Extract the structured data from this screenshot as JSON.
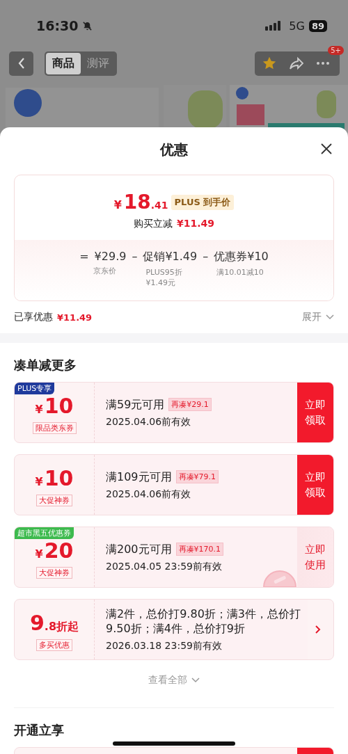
{
  "status_bar": {
    "time": "16:30",
    "network": "5G",
    "battery": "89"
  },
  "nav": {
    "tabs": [
      {
        "label": "商品",
        "selected": true
      },
      {
        "label": "测评",
        "selected": false
      }
    ],
    "badge": "5+"
  },
  "sheet": {
    "title": "优惠"
  },
  "price_summary": {
    "currency": "¥",
    "integer": "18",
    "decimal": ".41",
    "tag": "PLUS 到手价",
    "saving_label": "购买立减",
    "saving_amount": "¥11.49",
    "breakdown": [
      {
        "operator": "=",
        "value": "¥29.9",
        "notes": [
          "京东价"
        ]
      },
      {
        "operator": "–",
        "value": "促销¥1.49",
        "notes": [
          "PLUS95折",
          "¥1.49元"
        ]
      },
      {
        "operator": "–",
        "value": "优惠券¥10",
        "notes": [
          "满10.01减10"
        ]
      }
    ]
  },
  "enjoyed": {
    "label": "已享优惠",
    "amount": "¥11.49",
    "expand": "展开"
  },
  "more_section": {
    "title": "凑单减更多",
    "coupons": [
      {
        "badge": "PLUS专享",
        "color": "#1f3a9c",
        "currency": "¥",
        "amount": "10",
        "tag": "限品类东券",
        "condition": "满59元可用",
        "gap": "再凑¥29.1",
        "validity": "2025.04.06前有效",
        "kind": "claim",
        "action": "立即领取",
        "stamped": false
      },
      {
        "currency": "¥",
        "amount": "10",
        "tag": "大促神券",
        "condition": "满109元可用",
        "gap": "再凑¥79.1",
        "validity": "2025.04.06前有效",
        "kind": "claim",
        "action": "立即领取",
        "stamped": false
      },
      {
        "badge": "超市黑五优惠券",
        "color": "#3dba4e",
        "currency": "¥",
        "amount": "20",
        "tag": "大促神券",
        "condition": "满200元可用",
        "gap": "再凑¥170.1",
        "validity": "2025.04.05 23:59前有效",
        "kind": "use",
        "action": "立即使用",
        "stamped": true
      },
      {
        "amount": "9",
        "suffix": ".8折起",
        "tag": "多买优惠",
        "condition": "满2件，总价打9.80折；满3件，总价打9.50折；满4件，总价打9折",
        "validity": "2026.03.18 23:59前有效",
        "kind": "more",
        "stamped": false
      }
    ],
    "view_all": "查看全部"
  },
  "join_section": {
    "title": "开通立享"
  }
}
